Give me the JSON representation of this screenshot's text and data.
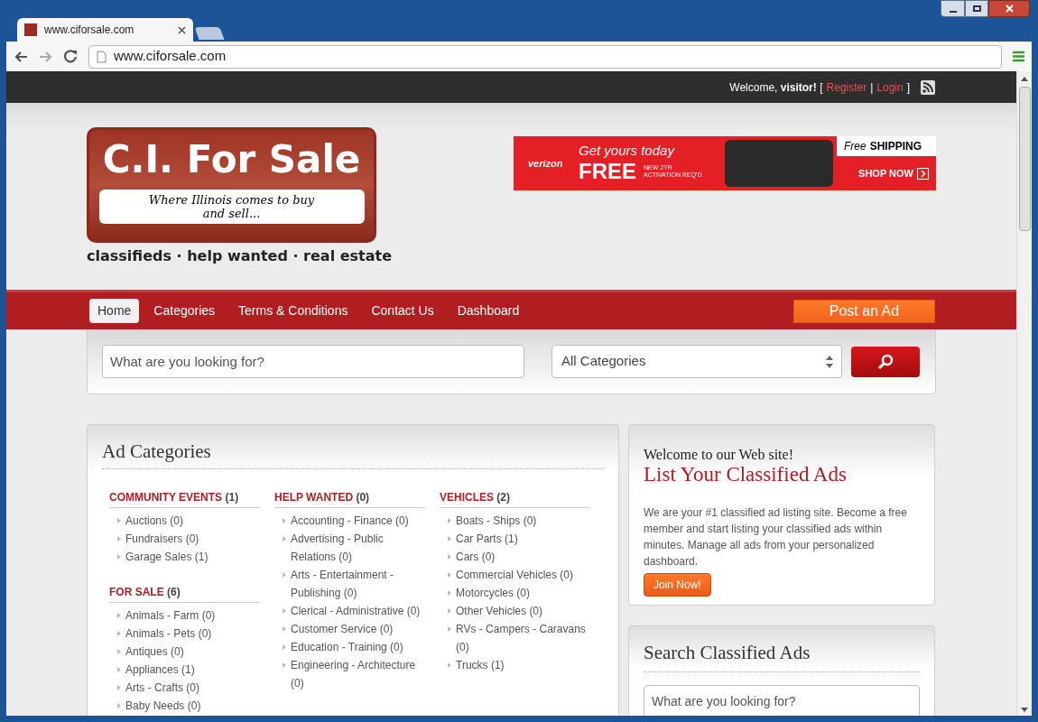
{
  "browser": {
    "tab_title": "www.ciforsale.com",
    "url": "www.ciforsale.com"
  },
  "top_bar": {
    "items": [
      {
        "kind": "text",
        "text": "Welcome, **visitor!** ["
      },
      {
        "kind": "link",
        "text": "Register"
      },
      {
        "kind": "text",
        "text": "|"
      },
      {
        "kind": "link",
        "text": "Login"
      },
      {
        "kind": "text",
        "text": "]"
      }
    ]
  },
  "logo": {
    "title": "C.I. For Sale",
    "tagline": "Where Illinois comes to buy and sell...",
    "subtitle": "classifieds · help wanted · real estate"
  },
  "ad": {
    "brand": "verizon",
    "headline": "Get yours today",
    "offer": "FREE",
    "fine_print": "NEW 2YR ACTIVATION REQ'D.",
    "shipping_free": "Free",
    "shipping": "SHIPPING",
    "cta": "SHOP NOW"
  },
  "nav": {
    "items": [
      {
        "label": "Home",
        "selected": true
      },
      {
        "label": "Categories",
        "selected": false
      },
      {
        "label": "Terms & Conditions",
        "selected": false
      },
      {
        "label": "Contact Us",
        "selected": false
      },
      {
        "label": "Dashboard",
        "selected": false
      }
    ],
    "post_button": "Post an Ad"
  },
  "search": {
    "placeholder": "What are you looking for?",
    "category": "All Categories"
  },
  "categories": {
    "title": "Ad Categories",
    "columns": [
      [
        {
          "name": "COMMUNITY EVENTS",
          "count": "(1)",
          "items": [
            "Auctions (0)",
            "Fundraisers (0)",
            "Garage Sales (1)"
          ]
        },
        {
          "name": "FOR SALE",
          "count": "(6)",
          "items": [
            "Animals - Farm (0)",
            "Animals - Pets (0)",
            "Antiques (0)",
            "Appliances (1)",
            "Arts - Crafts (0)",
            "Baby Needs (0)"
          ]
        }
      ],
      [
        {
          "name": "HELP WANTED",
          "count": "(0)",
          "items": [
            "Accounting - Finance (0)",
            "Advertising - Public Relations (0)",
            "Arts - Entertainment - Publishing (0)",
            "Clerical - Administrative (0)",
            "Customer Service (0)",
            "Education - Training (0)",
            "Engineering - Architecture (0)"
          ]
        }
      ],
      [
        {
          "name": "VEHICLES",
          "count": "(2)",
          "items": [
            "Boats - Ships (0)",
            "Car Parts (1)",
            "Cars (0)",
            "Commercial Vehicles (0)",
            "Motorcycles (0)",
            "Other Vehicles (0)",
            "RVs - Campers - Caravans (0)",
            "Trucks (1)"
          ]
        }
      ]
    ]
  },
  "welcome_box": {
    "intro": "Welcome to our Web site!",
    "title": "List Your Classified Ads",
    "body": "We are your #1 classified ad listing site. Become a free member and start listing your classified ads within minutes. Manage all ads from your personalized dashboard.",
    "button": "Join Now!"
  },
  "search_box": {
    "title": "Search Classified Ads",
    "placeholder": "What are you looking for?"
  }
}
